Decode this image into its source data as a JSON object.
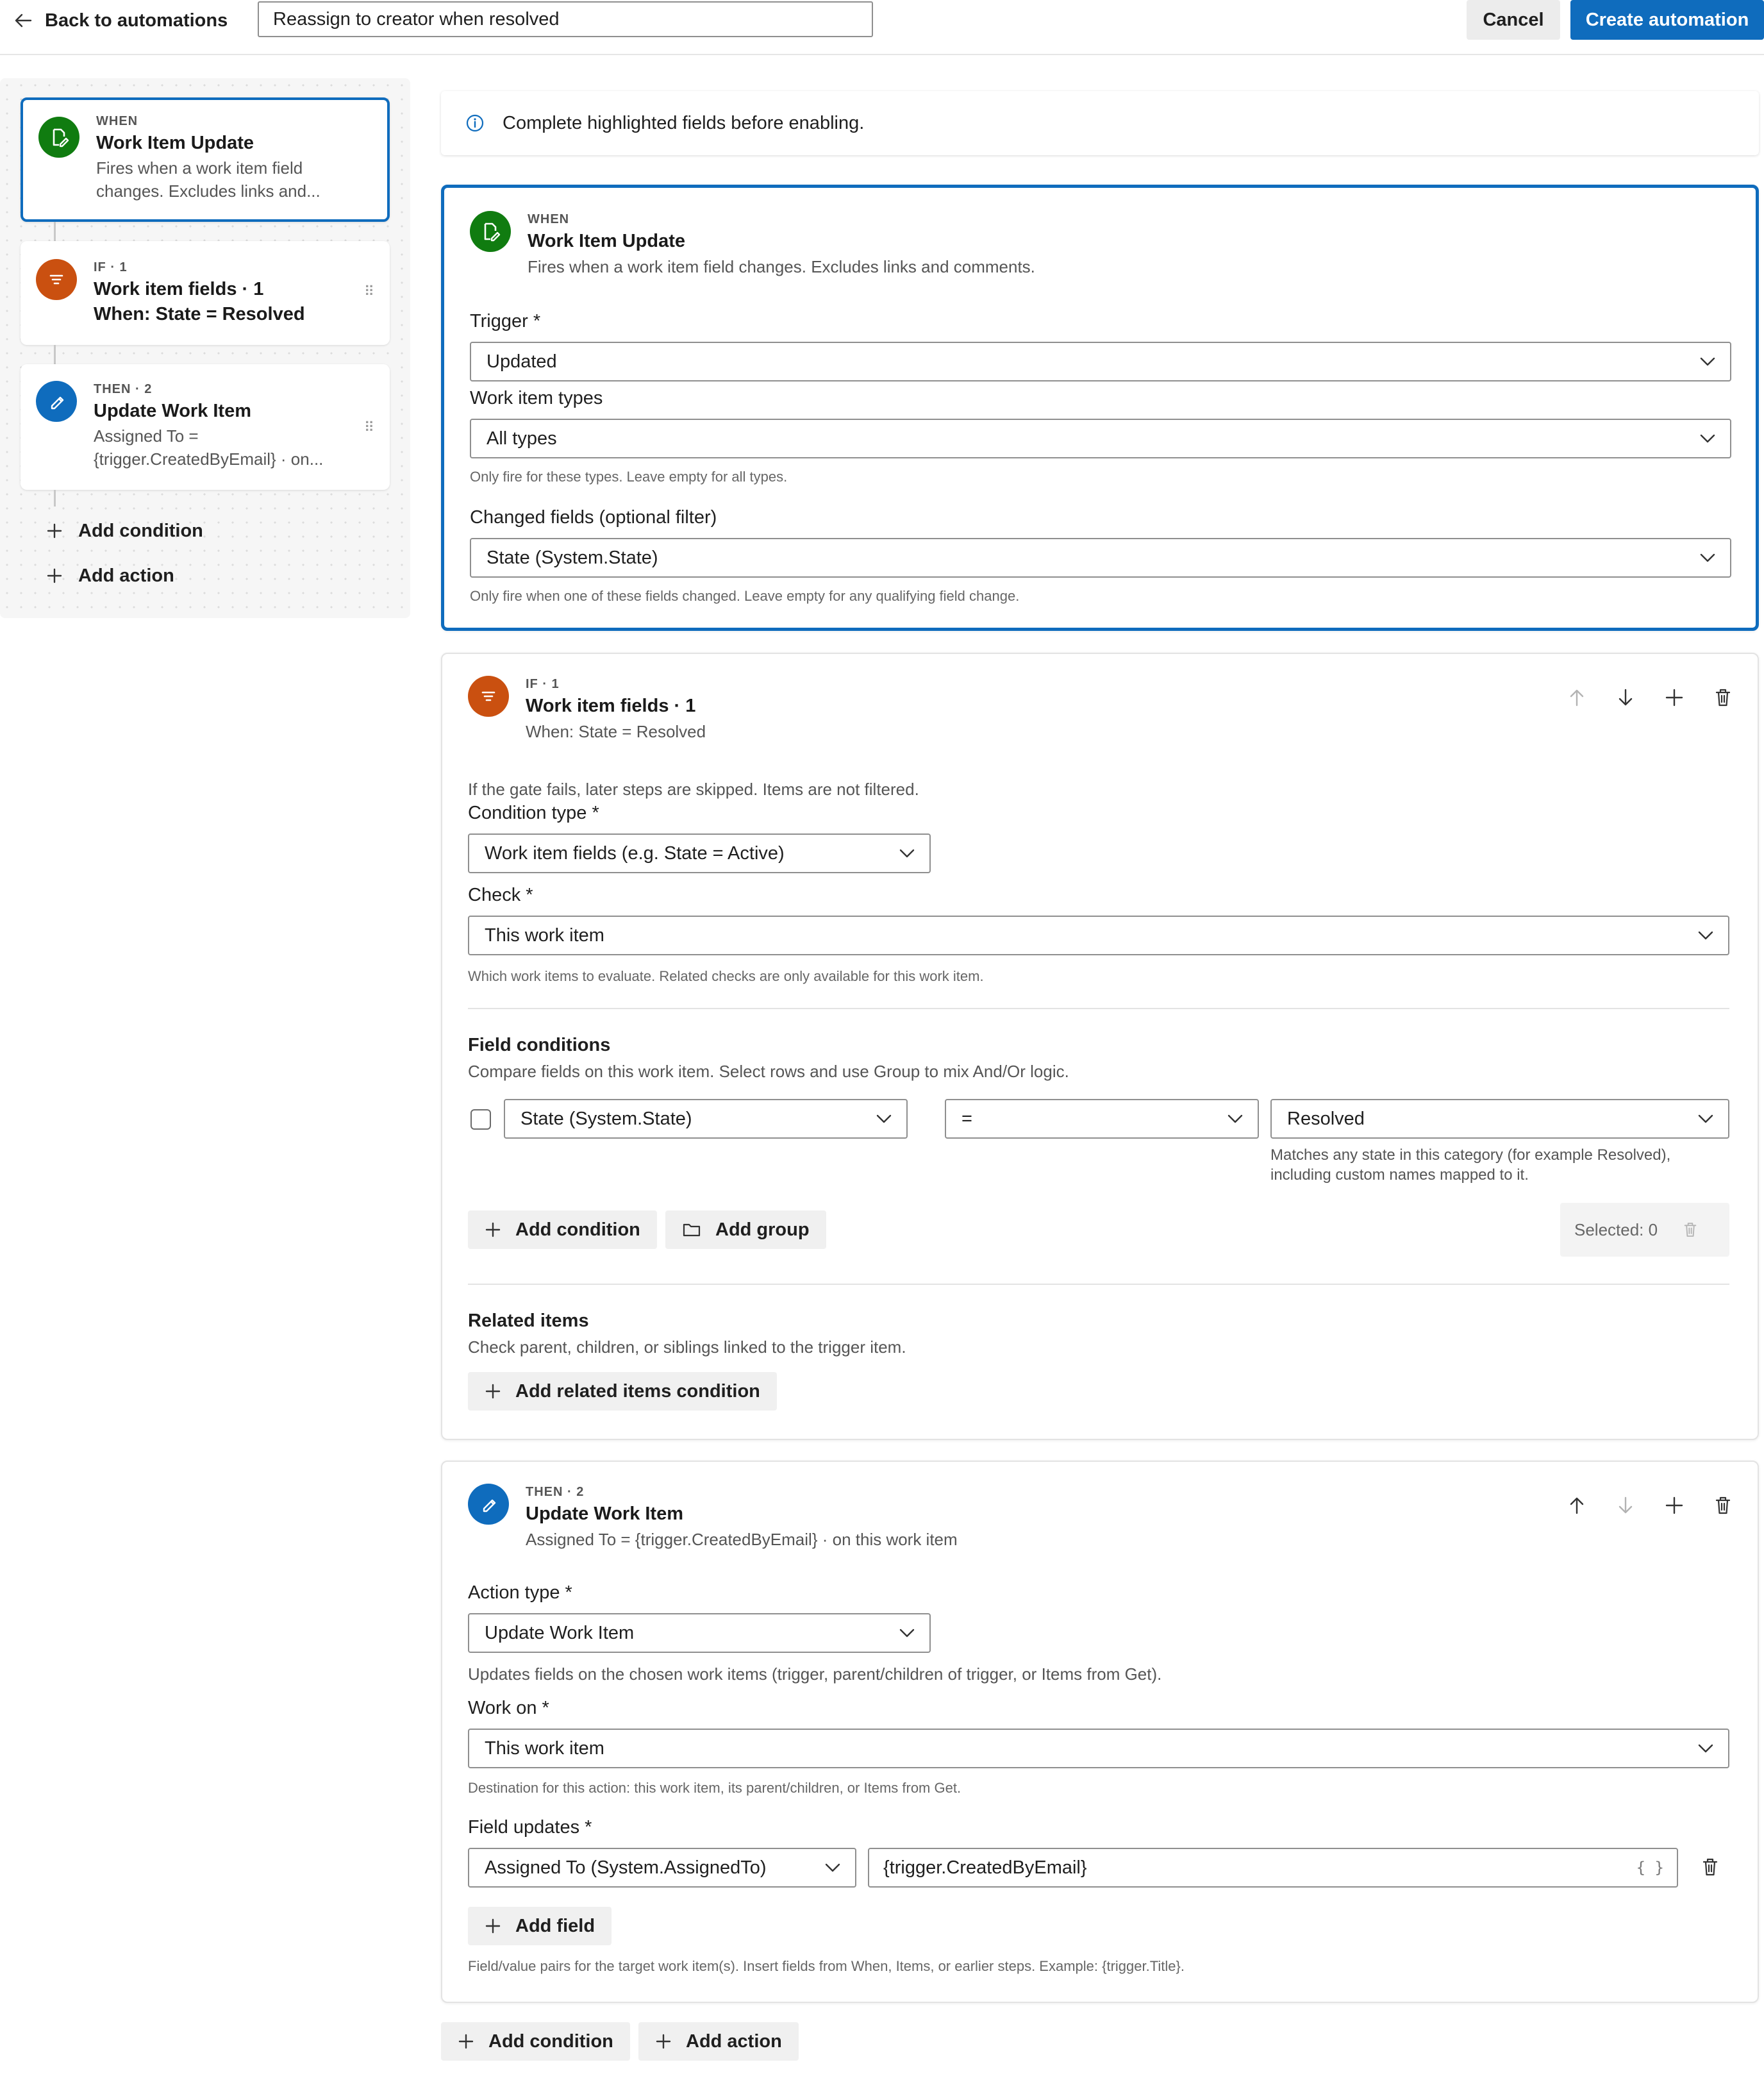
{
  "topbar": {
    "back_label": "Back to automations",
    "automation_name": "Reassign to creator when resolved",
    "cancel_label": "Cancel",
    "create_label": "Create automation"
  },
  "flow": {
    "when": {
      "eyebrow": "WHEN",
      "title": "Work Item Update",
      "desc": "Fires when a work item field changes. Excludes links and..."
    },
    "if": {
      "eyebrow": "IF · 1",
      "title": "Work item fields · 1",
      "sub": "When: State = Resolved"
    },
    "then": {
      "eyebrow": "THEN · 2",
      "title": "Update Work Item",
      "desc": "Assigned To = {trigger.CreatedByEmail} · on..."
    },
    "add_condition": "Add condition",
    "add_action": "Add action"
  },
  "banner": {
    "text": "Complete highlighted fields before enabling."
  },
  "when_card": {
    "eyebrow": "WHEN",
    "title": "Work Item Update",
    "desc": "Fires when a work item field changes. Excludes links and comments.",
    "trigger_label": "Trigger *",
    "trigger_value": "Updated",
    "types_label": "Work item types",
    "types_value": "All types",
    "types_hint": "Only fire for these types. Leave empty for all types.",
    "changed_label": "Changed fields (optional filter)",
    "changed_value": "State (System.State)",
    "changed_hint": "Only fire when one of these fields changed. Leave empty for any qualifying field change."
  },
  "if_card": {
    "eyebrow": "IF · 1",
    "title": "Work item fields · 1",
    "desc": "When: State = Resolved",
    "gate_note": "If the gate fails, later steps are skipped. Items are not filtered.",
    "condition_type_label": "Condition type *",
    "condition_type_value": "Work item fields (e.g. State = Active)",
    "check_label": "Check *",
    "check_value": "This work item",
    "check_hint": "Which work items to evaluate. Related checks are only available for this work item.",
    "field_conditions_title": "Field conditions",
    "field_conditions_desc": "Compare fields on this work item. Select rows and use Group to mix And/Or logic.",
    "row": {
      "field": "State (System.State)",
      "operator": "=",
      "value": "Resolved",
      "value_hint": "Matches any state in this category (for example Resolved), including custom names mapped to it."
    },
    "add_condition": "Add condition",
    "add_group": "Add group",
    "selected_label": "Selected: 0",
    "related_title": "Related items",
    "related_desc": "Check parent, children, or siblings linked to the trigger item.",
    "add_related": "Add related items condition"
  },
  "then_card": {
    "eyebrow": "THEN · 2",
    "title": "Update Work Item",
    "desc": "Assigned To = {trigger.CreatedByEmail} · on this work item",
    "action_type_label": "Action type *",
    "action_type_value": "Update Work Item",
    "action_note": "Updates fields on the chosen work items (trigger, parent/children of trigger, or Items from Get).",
    "work_on_label": "Work on *",
    "work_on_value": "This work item",
    "work_on_hint": "Destination for this action: this work item, its parent/children, or Items from Get.",
    "field_updates_label": "Field updates *",
    "field_select": "Assigned To (System.AssignedTo)",
    "field_value": "{trigger.CreatedByEmail}",
    "braces": "{ }",
    "add_field": "Add field",
    "field_hint": "Field/value pairs for the target work item(s). Insert fields from When, Items, or earlier steps. Example: {trigger.Title}."
  },
  "bottom": {
    "add_condition": "Add condition",
    "add_action": "Add action"
  },
  "colors": {
    "accent": "#0f6cbd",
    "when_icon": "#107c10",
    "if_icon": "#ca5010",
    "then_icon": "#0f6cbd"
  }
}
